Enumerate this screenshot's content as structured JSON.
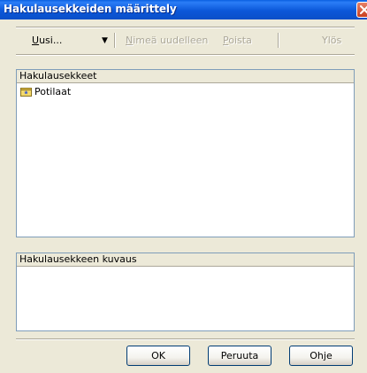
{
  "window": {
    "title": "Hakulausekkeiden määrittely"
  },
  "toolbar": {
    "new_label": "Uusi...",
    "new_accel": "U",
    "new_rest": "usi...",
    "dropdown_glyph": "▼",
    "rename_label": "Nimeä uudelleen",
    "rename_accel": "N",
    "rename_rest": "imeä uudelleen",
    "delete_label": "Poista",
    "delete_accel": "P",
    "delete_rest": "oista",
    "up_label": "Ylös"
  },
  "expressions_panel": {
    "header": "Hakulausekkeet",
    "items": [
      {
        "label": "Potilaat",
        "icon": "folder-star-icon"
      }
    ]
  },
  "description_panel": {
    "header": "Hakulausekkeen kuvaus",
    "text": ""
  },
  "buttons": {
    "ok": "OK",
    "cancel": "Peruuta",
    "help": "Ohje"
  },
  "colors": {
    "titlebar": "#0a57d9",
    "dialog_bg": "#ece9d8",
    "panel_border": "#7f9db9",
    "disabled_text": "#aca899"
  }
}
